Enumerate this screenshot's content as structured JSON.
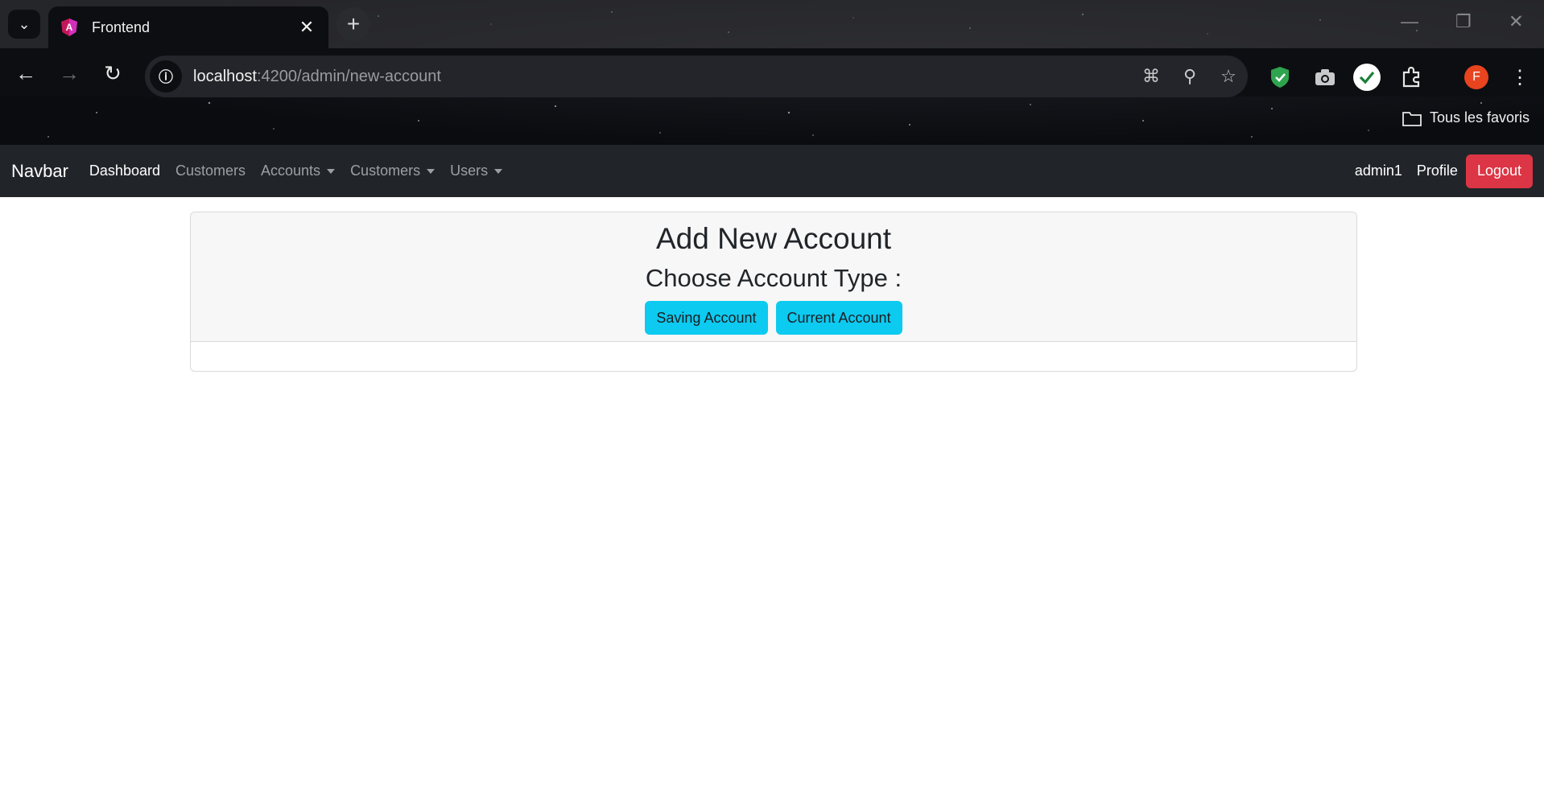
{
  "browser": {
    "tab_title": "Frontend",
    "url_host": "localhost",
    "url_path": ":4200/admin/new-account",
    "bookmarks_label": "Tous les favoris",
    "profile_initial": "F",
    "icons": {
      "tab_search": "chevron-down-icon",
      "tab_close": "close-icon",
      "new_tab": "plus-icon",
      "back": "arrow-left-icon",
      "forward": "arrow-right-icon",
      "reload": "reload-icon",
      "site_info": "info-icon",
      "translate": "translate-icon",
      "zoom": "zoom-out-icon",
      "bookmark": "star-icon",
      "extensions": "puzzle-icon",
      "menu": "kebab-menu-icon"
    }
  },
  "navbar": {
    "brand": "Navbar",
    "links": {
      "dashboard": "Dashboard",
      "customers": "Customers",
      "accounts": "Accounts",
      "customers_dropdown": "Customers",
      "users": "Users"
    },
    "username": "admin1",
    "profile": "Profile",
    "logout": "Logout"
  },
  "card": {
    "title": "Add New Account",
    "subtitle": "Choose Account Type :",
    "buttons": {
      "saving": "Saving Account",
      "current": "Current Account"
    }
  },
  "colors": {
    "navbar_bg": "#212529",
    "logout_bg": "#dc3545",
    "button_info_bg": "#0dcaf0",
    "card_header_bg": "#f7f7f7"
  }
}
